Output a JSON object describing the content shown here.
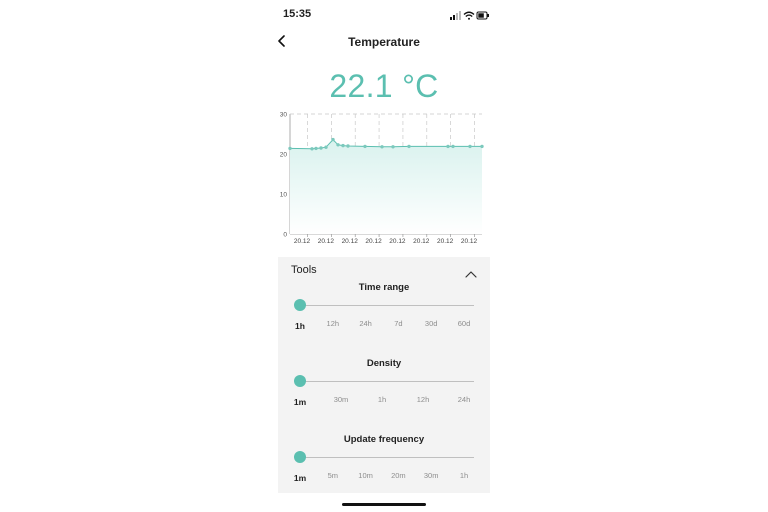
{
  "status_bar": {
    "time": "15:35"
  },
  "header": {
    "title": "Temperature"
  },
  "reading": {
    "value": "22.1 °C"
  },
  "colors": {
    "accent": "#5bbfb0",
    "fill": "#dff4f1",
    "grid": "#c8c8c8"
  },
  "chart_data": {
    "type": "area",
    "ylim": [
      0,
      30
    ],
    "yticks": [
      "30",
      "20",
      "10",
      "0"
    ],
    "xticks": [
      "20.12",
      "20.12",
      "20.12",
      "20.12",
      "20.12",
      "20.12",
      "20.12",
      "20.12"
    ],
    "series": [
      {
        "values": [
          21.4,
          21.3,
          21.4,
          21.5,
          21.7,
          23.6,
          22.3,
          22.1,
          22.0,
          21.9,
          21.8,
          21.8,
          21.9,
          21.9,
          21.9,
          21.9,
          21.9
        ]
      }
    ]
  },
  "tools": {
    "title": "Tools",
    "time_range": {
      "title": "Time range",
      "options": [
        "1h",
        "12h",
        "24h",
        "7d",
        "30d",
        "60d"
      ],
      "selected": 0
    },
    "density": {
      "title": "Density",
      "options": [
        "1m",
        "30m",
        "1h",
        "12h",
        "24h"
      ],
      "selected": 0
    },
    "update_frequency": {
      "title": "Update frequency",
      "options": [
        "1m",
        "5m",
        "10m",
        "20m",
        "30m",
        "1h"
      ],
      "selected": 0
    }
  }
}
